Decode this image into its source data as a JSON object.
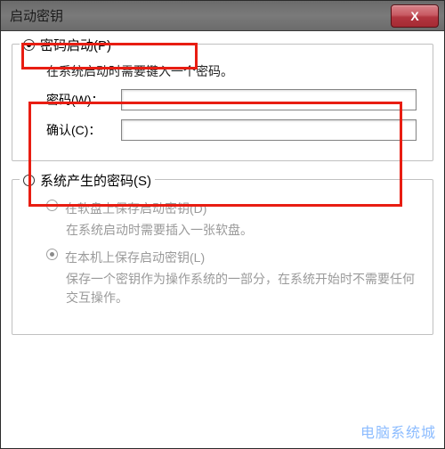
{
  "window": {
    "title": "启动密钥"
  },
  "close": {
    "glyph": "X"
  },
  "group_pw": {
    "legend": "密码启动(P)",
    "desc": "在系统启动时需要键入一个密码。",
    "pw_label": "密码(W)：",
    "confirm_label": "确认(C)：",
    "pw_value": "",
    "confirm_value": ""
  },
  "group_sys": {
    "legend": "系统产生的密码(S)",
    "opt_floppy": "在软盘上保存启动密钥(D)",
    "opt_floppy_desc": "在系统启动时需要插入一张软盘。",
    "opt_local": "在本机上保存启动密钥(L)",
    "opt_local_desc": "保存一个密钥作为操作系统的一部分，在系统开始时不需要任何交互操作。"
  },
  "watermark": "电脑系统城"
}
